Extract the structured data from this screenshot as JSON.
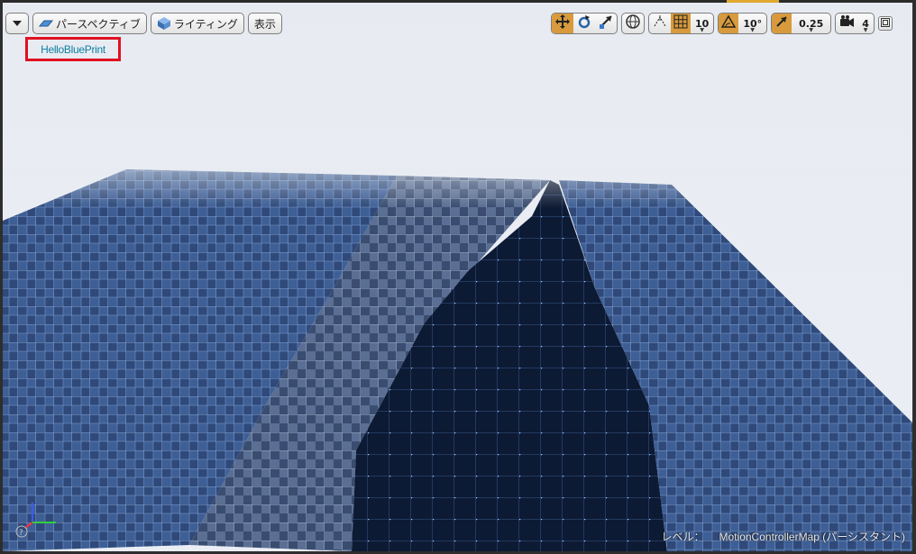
{
  "toolbar": {
    "perspective_label": "パースペクティブ",
    "lighting_label": "ライティング",
    "show_label": "表示",
    "grid_snap_value": "10",
    "rotation_snap_value": "10°",
    "scale_snap_value": "0.25",
    "camera_speed_value": "4"
  },
  "viewport": {
    "title": "HelloBluePrint",
    "status_label": "レベル：",
    "status_value": "MotionControllerMap (パーシスタント)"
  },
  "icons": [
    "dropdown-arrow-icon",
    "perspective-icon",
    "lighting-cube-icon",
    "translate-icon",
    "rotate-icon",
    "scale-icon",
    "world-icon",
    "surface-snap-icon",
    "grid-icon",
    "rotation-snap-icon",
    "scale-snap-icon",
    "camera-speed-icon",
    "maximize-icon",
    "axis-gizmo-icon"
  ],
  "colors": {
    "accent": "#d89a3c",
    "highlight_border": "#e01020",
    "title_text": "#0d7fa3"
  }
}
